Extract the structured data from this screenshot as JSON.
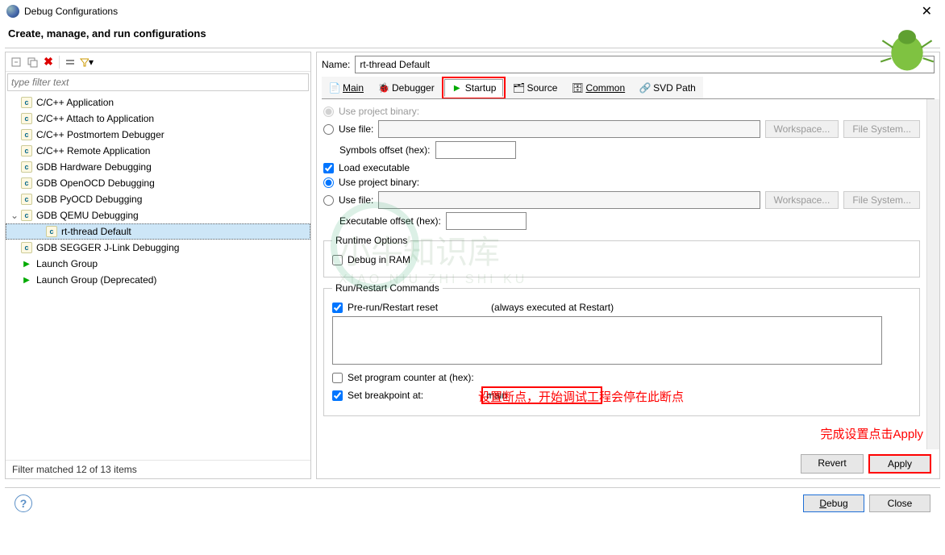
{
  "window": {
    "title": "Debug Configurations",
    "close": "✕"
  },
  "header": {
    "title": "Create, manage, and run configurations"
  },
  "left": {
    "filter_placeholder": "type filter text",
    "items": [
      {
        "label": "C/C++ Application",
        "type": "c"
      },
      {
        "label": "C/C++ Attach to Application",
        "type": "c"
      },
      {
        "label": "C/C++ Postmortem Debugger",
        "type": "c"
      },
      {
        "label": "C/C++ Remote Application",
        "type": "c"
      },
      {
        "label": "GDB Hardware Debugging",
        "type": "c"
      },
      {
        "label": "GDB OpenOCD Debugging",
        "type": "c"
      },
      {
        "label": "GDB PyOCD Debugging",
        "type": "c"
      },
      {
        "label": "GDB QEMU Debugging",
        "type": "c",
        "expanded": true,
        "children": [
          {
            "label": "rt-thread Default",
            "type": "c",
            "selected": true
          }
        ]
      },
      {
        "label": "GDB SEGGER J-Link Debugging",
        "type": "c"
      },
      {
        "label": "Launch Group",
        "type": "play"
      },
      {
        "label": "Launch Group (Deprecated)",
        "type": "play"
      }
    ],
    "status": "Filter matched 12 of 13 items"
  },
  "right": {
    "name_label": "Name:",
    "name_value": "rt-thread Default",
    "tabs": [
      {
        "label": "Main",
        "icon": "file"
      },
      {
        "label": "Debugger",
        "icon": "bug"
      },
      {
        "label": "Startup",
        "icon": "play",
        "selected": true,
        "highlight": true
      },
      {
        "label": "Source",
        "icon": "source"
      },
      {
        "label": "Common",
        "icon": "common"
      },
      {
        "label": "SVD Path",
        "icon": "svd"
      }
    ],
    "form": {
      "use_project_binary_1": "Use project binary:",
      "use_file": "Use file:",
      "workspace_btn": "Workspace...",
      "filesystem_btn": "File System...",
      "symbols_offset": "Symbols offset (hex):",
      "load_executable": "Load executable",
      "use_project_binary_2": "Use project binary:",
      "executable_offset": "Executable offset (hex):",
      "runtime_options": "Runtime Options",
      "debug_in_ram": "Debug in RAM",
      "run_restart": "Run/Restart Commands",
      "pre_run_reset": "Pre-run/Restart reset",
      "always_executed": "(always executed at Restart)",
      "set_pc": "Set program counter at (hex):",
      "set_breakpoint": "Set breakpoint at:",
      "breakpoint_value": "main"
    },
    "actions": {
      "revert": "Revert",
      "apply": "Apply"
    }
  },
  "footer": {
    "debug": "Debug",
    "close": "Close"
  },
  "annotations": {
    "breakpoint_note": "设置断点，开始调试工程会停在此断点",
    "apply_note": "完成设置点击Apply"
  }
}
